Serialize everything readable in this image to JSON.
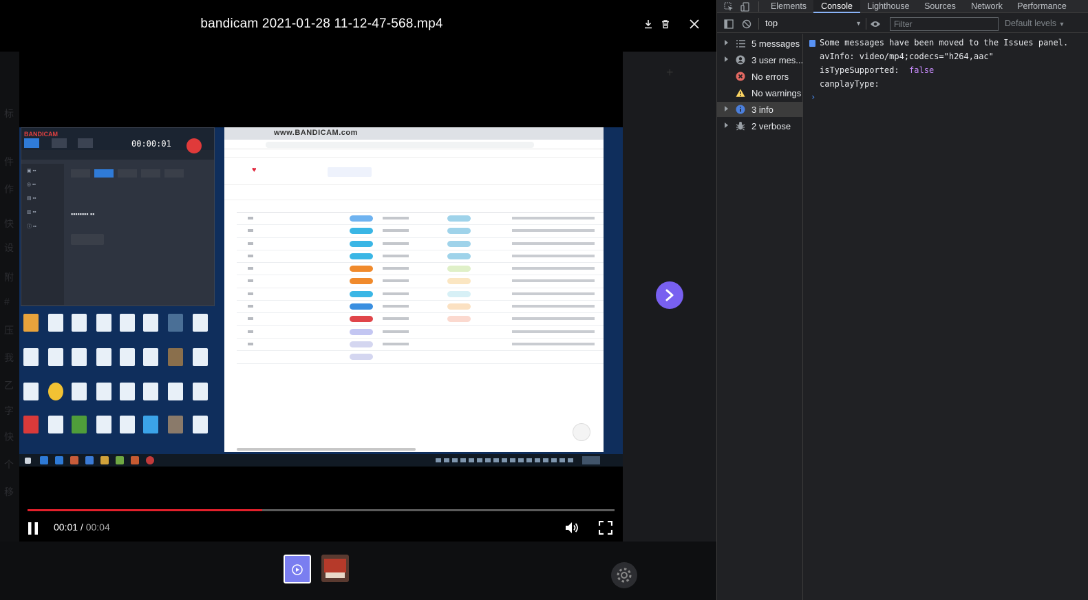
{
  "viewer": {
    "title": "bandicam 2021-01-28 11-12-47-568.mp4",
    "player": {
      "time_current": "00:01",
      "time_separator": " / ",
      "time_total": "00:04",
      "progress": 0.4
    },
    "recorder": {
      "logo": "BANDICAM",
      "timer": "00:00:01"
    },
    "browser": {
      "watermark": "www.BANDICAM.com"
    }
  },
  "devtools": {
    "tabs": [
      {
        "label": "Elements",
        "active": false
      },
      {
        "label": "Console",
        "active": true
      },
      {
        "label": "Lighthouse",
        "active": false
      },
      {
        "label": "Sources",
        "active": false
      },
      {
        "label": "Network",
        "active": false
      },
      {
        "label": "Performance",
        "active": false
      }
    ],
    "context": "top",
    "filter_placeholder": "Filter",
    "levels": "Default levels",
    "sidebar": [
      {
        "label": "5 messages",
        "icon": "list-icon",
        "expandable": true,
        "selected": false
      },
      {
        "label": "3 user mes...",
        "icon": "user-icon",
        "expandable": true,
        "selected": false
      },
      {
        "label": "No errors",
        "icon": "error-icon",
        "expandable": false,
        "selected": false
      },
      {
        "label": "No warnings",
        "icon": "warning-icon",
        "expandable": false,
        "selected": false
      },
      {
        "label": "3 info",
        "icon": "info-icon",
        "expandable": true,
        "selected": true
      },
      {
        "label": "2 verbose",
        "icon": "bug-icon",
        "expandable": true,
        "selected": false
      }
    ],
    "console": {
      "issues_msg": "Some messages have been moved to the Issues panel.",
      "line1": "avInfo: video/mp4;codecs=\"h264,aac\"",
      "line2_key": "isTypeSupported:",
      "line2_val": "false",
      "line3": "canplayType:",
      "prompt": "›"
    }
  },
  "colors": {
    "accent": "#7860f0",
    "progress": "#e3202b",
    "devtools_bg": "#202124",
    "active_tab_underline": "#8ab4f8"
  }
}
